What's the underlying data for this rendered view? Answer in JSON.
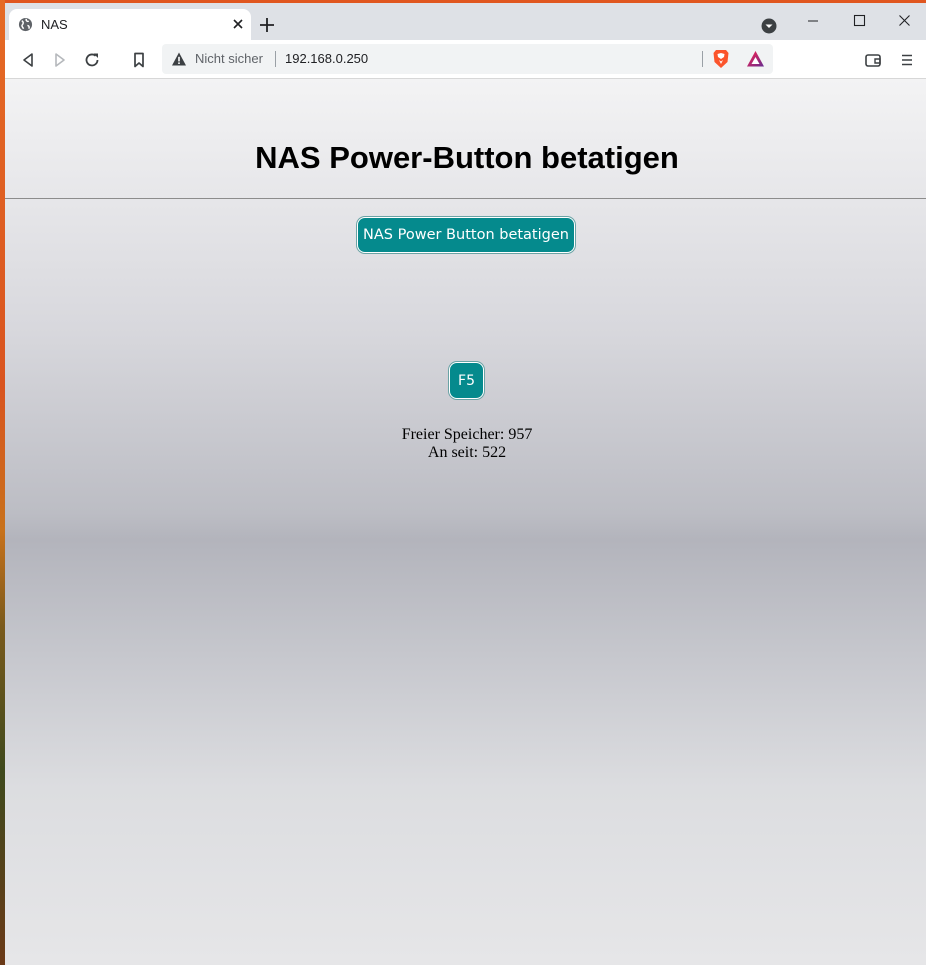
{
  "browser": {
    "tab": {
      "title": "NAS",
      "favicon": "globe-icon"
    },
    "address_bar": {
      "security_label": "Nicht sicher",
      "url": "192.168.0.250"
    },
    "icons": [
      "back-icon",
      "forward-icon",
      "reload-icon",
      "bookmark-icon",
      "brave-shields-icon",
      "brave-rewards-icon",
      "wallet-icon",
      "menu-icon"
    ]
  },
  "page": {
    "title": "NAS Power-Button betatigen",
    "power_button_label": "NAS Power Button betatigen",
    "refresh_button_label": "F5",
    "free_memory": "Freier Speicher: 957",
    "uptime": "An seit: 522"
  },
  "colors": {
    "button_background": "#058a8d",
    "tab_strip": "#dee1e6",
    "brave_orange": "#fb542b"
  }
}
